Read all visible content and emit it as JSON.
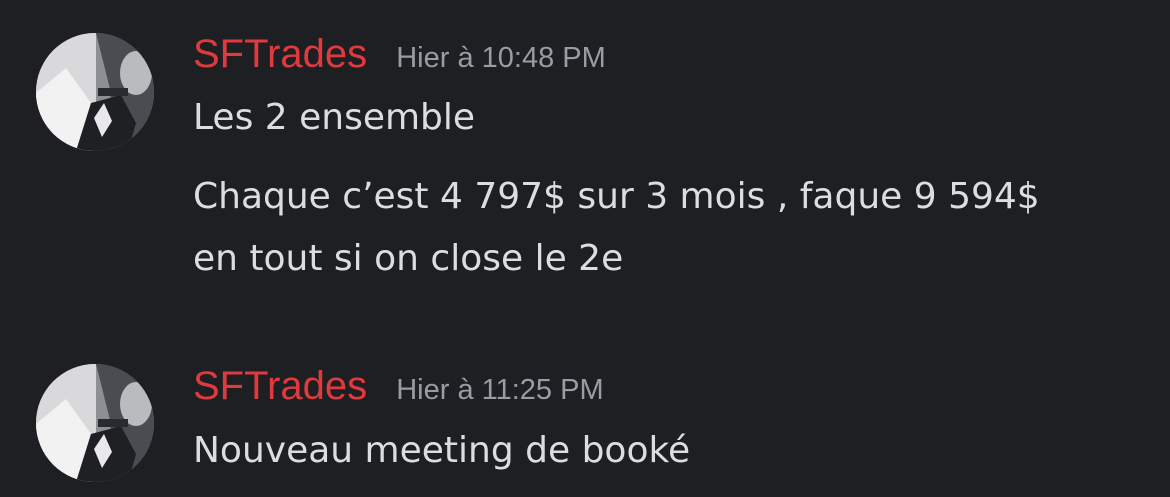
{
  "messages": [
    {
      "username": "SFTrades",
      "timestamp": "Hier à 10:48 PM",
      "lines": [
        "Les 2 ensemble",
        "Chaque c’est 4 797$ sur 3 mois , faque 9 594$",
        "en tout si on close le 2e"
      ]
    },
    {
      "username": "SFTrades",
      "timestamp": "Hier à 11:25 PM",
      "lines": [
        "Nouveau meeting de booké"
      ]
    }
  ],
  "colors": {
    "background": "#1e1f22",
    "username": "#e03a3e",
    "timestamp": "#9a9ba3",
    "text": "#dbdee1"
  }
}
